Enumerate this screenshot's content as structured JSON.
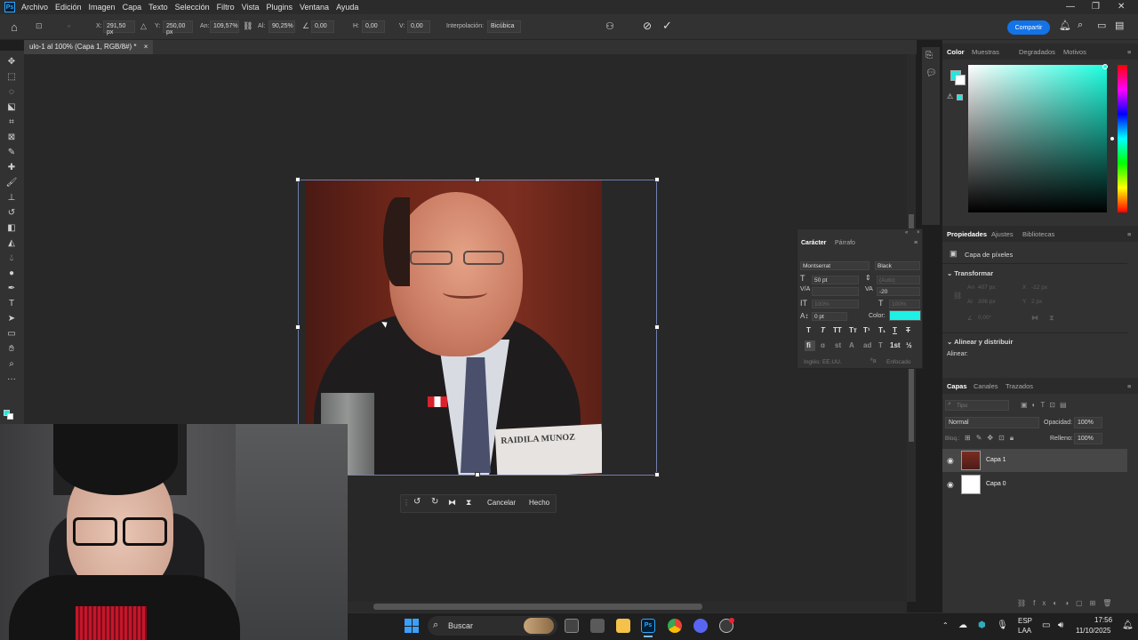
{
  "menubar": {
    "logo": "Ps",
    "items": [
      "Archivo",
      "Edición",
      "Imagen",
      "Capa",
      "Texto",
      "Selección",
      "Filtro",
      "Vista",
      "Plugins",
      "Ventana",
      "Ayuda"
    ]
  },
  "options": {
    "x_label": "X:",
    "x_value": "291,50 px",
    "y_label": "Y:",
    "y_value": "250,00 px",
    "w_label": "An:",
    "w_value": "109,57%",
    "h_label": "Al:",
    "h_value": "90,25%",
    "angle_value": "0,00",
    "hskew_label": "H:",
    "hskew_value": "0,00",
    "vskew_label": "V:",
    "vskew_value": "0,00",
    "interp_label": "Interpolación:",
    "interp_value": "Bicúbica",
    "share_label": "Compartir"
  },
  "document": {
    "tab_title": "ulo-1 al 100% (Capa 1, RGB/8#) *"
  },
  "transform_bar": {
    "cancel_label": "Cancelar",
    "done_label": "Hecho"
  },
  "color_panel": {
    "tabs": [
      "Color",
      "Muestras",
      "Degradados",
      "Motivos"
    ],
    "foreground": "#1de9e0",
    "background": "#ffffff"
  },
  "character_panel": {
    "tabs": [
      "Carácter",
      "Párrafo"
    ],
    "font_family": "Montserrat",
    "font_style": "Black",
    "size": "50 pt",
    "leading": "(Auto)",
    "tracking": "-20",
    "vscale": "100%",
    "hscale": "100%",
    "baseline": "0 pt",
    "color_label": "Color:",
    "color": "#1ef0e6",
    "language": "Inglés: EE.UU.",
    "antialias": "Enfocado",
    "style_buttons": [
      "T",
      "T",
      "TT",
      "Tт",
      "T¹",
      "T₁",
      "T",
      "T"
    ],
    "ligature_buttons": [
      "ﬁ",
      "ɑ",
      "st",
      "A",
      "ad",
      "T",
      "1st",
      "½"
    ]
  },
  "properties": {
    "tabs": [
      "Propiedades",
      "Ajustes",
      "Bibliotecas"
    ],
    "layer_type": "Capa de píxeles",
    "transform_label": "Transformar",
    "w_label": "An",
    "w_value": "407 px",
    "x_label": "X",
    "x_value": "-12 px",
    "h_label": "Al",
    "h_value": "306 px",
    "y_label": "Y",
    "y_value": "2 px",
    "angle_value": "0,00°",
    "align_label": "Alinear y distribuir",
    "align_sub": "Alinear:"
  },
  "layers": {
    "tabs": [
      "Capas",
      "Canales",
      "Trazados"
    ],
    "filter_placeholder": "Tipo",
    "blend_mode": "Normal",
    "opacity_label": "Opacidad:",
    "opacity_value": "100%",
    "lock_label": "Bloq.:",
    "fill_label": "Relleno:",
    "fill_value": "100%",
    "items": [
      {
        "name": "Capa 1",
        "selected": true
      },
      {
        "name": "Capa 0",
        "selected": false
      }
    ]
  },
  "photo": {
    "nameplate": "RAIDILA MUNOZ"
  },
  "taskbar": {
    "search_label": "Buscar",
    "lang_top": "ESP",
    "lang_bottom": "LAA",
    "time": "17:56",
    "date": "11/10/2025"
  }
}
